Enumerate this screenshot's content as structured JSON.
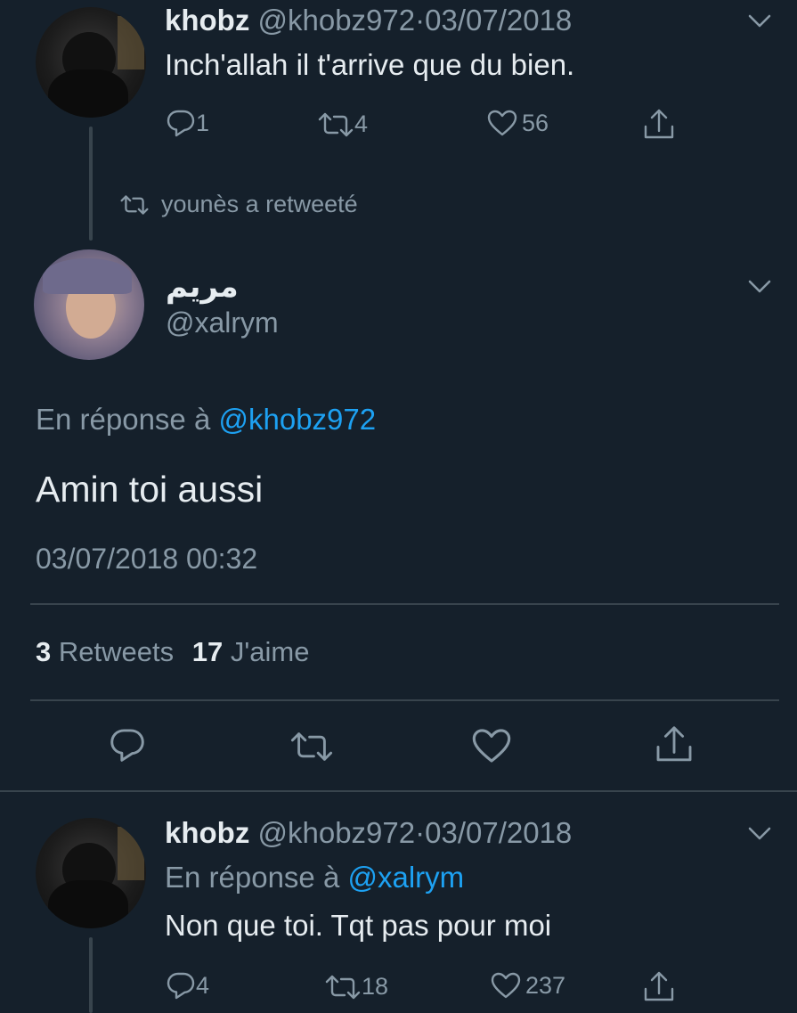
{
  "tweet1": {
    "author_name": "khobz",
    "author_handle": "@khobz972",
    "separator": "·",
    "date": "03/07/2018",
    "text": "Inch'allah il t'arrive que du bien.",
    "replies": "1",
    "retweets": "4",
    "likes": "56"
  },
  "retweet_notice": {
    "text": "younès a retweeté"
  },
  "main_tweet": {
    "author_name": "مريم",
    "author_handle": "@xalrym",
    "reply_prefix": "En réponse à",
    "reply_to": "@khobz972",
    "text": "Amin toi aussi",
    "timestamp": "03/07/2018 00:32",
    "retweet_count": "3",
    "retweet_label": "Retweets",
    "like_count": "17",
    "like_label": "J'aime"
  },
  "tweet3": {
    "author_name": "khobz",
    "author_handle": "@khobz972",
    "separator": "·",
    "date": "03/07/2018",
    "reply_prefix": "En réponse à",
    "reply_to": "@xalrym",
    "text": "Non que toi. Tqt pas pour moi",
    "replies": "4",
    "retweets": "18",
    "likes": "237"
  },
  "icons": [
    "reply-icon",
    "retweet-icon",
    "like-icon",
    "share-icon",
    "chevron-down-icon"
  ],
  "colors": {
    "background": "#15202b",
    "text": "#e6ecf0",
    "muted": "#8899a6",
    "link": "#1da1f2",
    "divider": "#38444d"
  }
}
